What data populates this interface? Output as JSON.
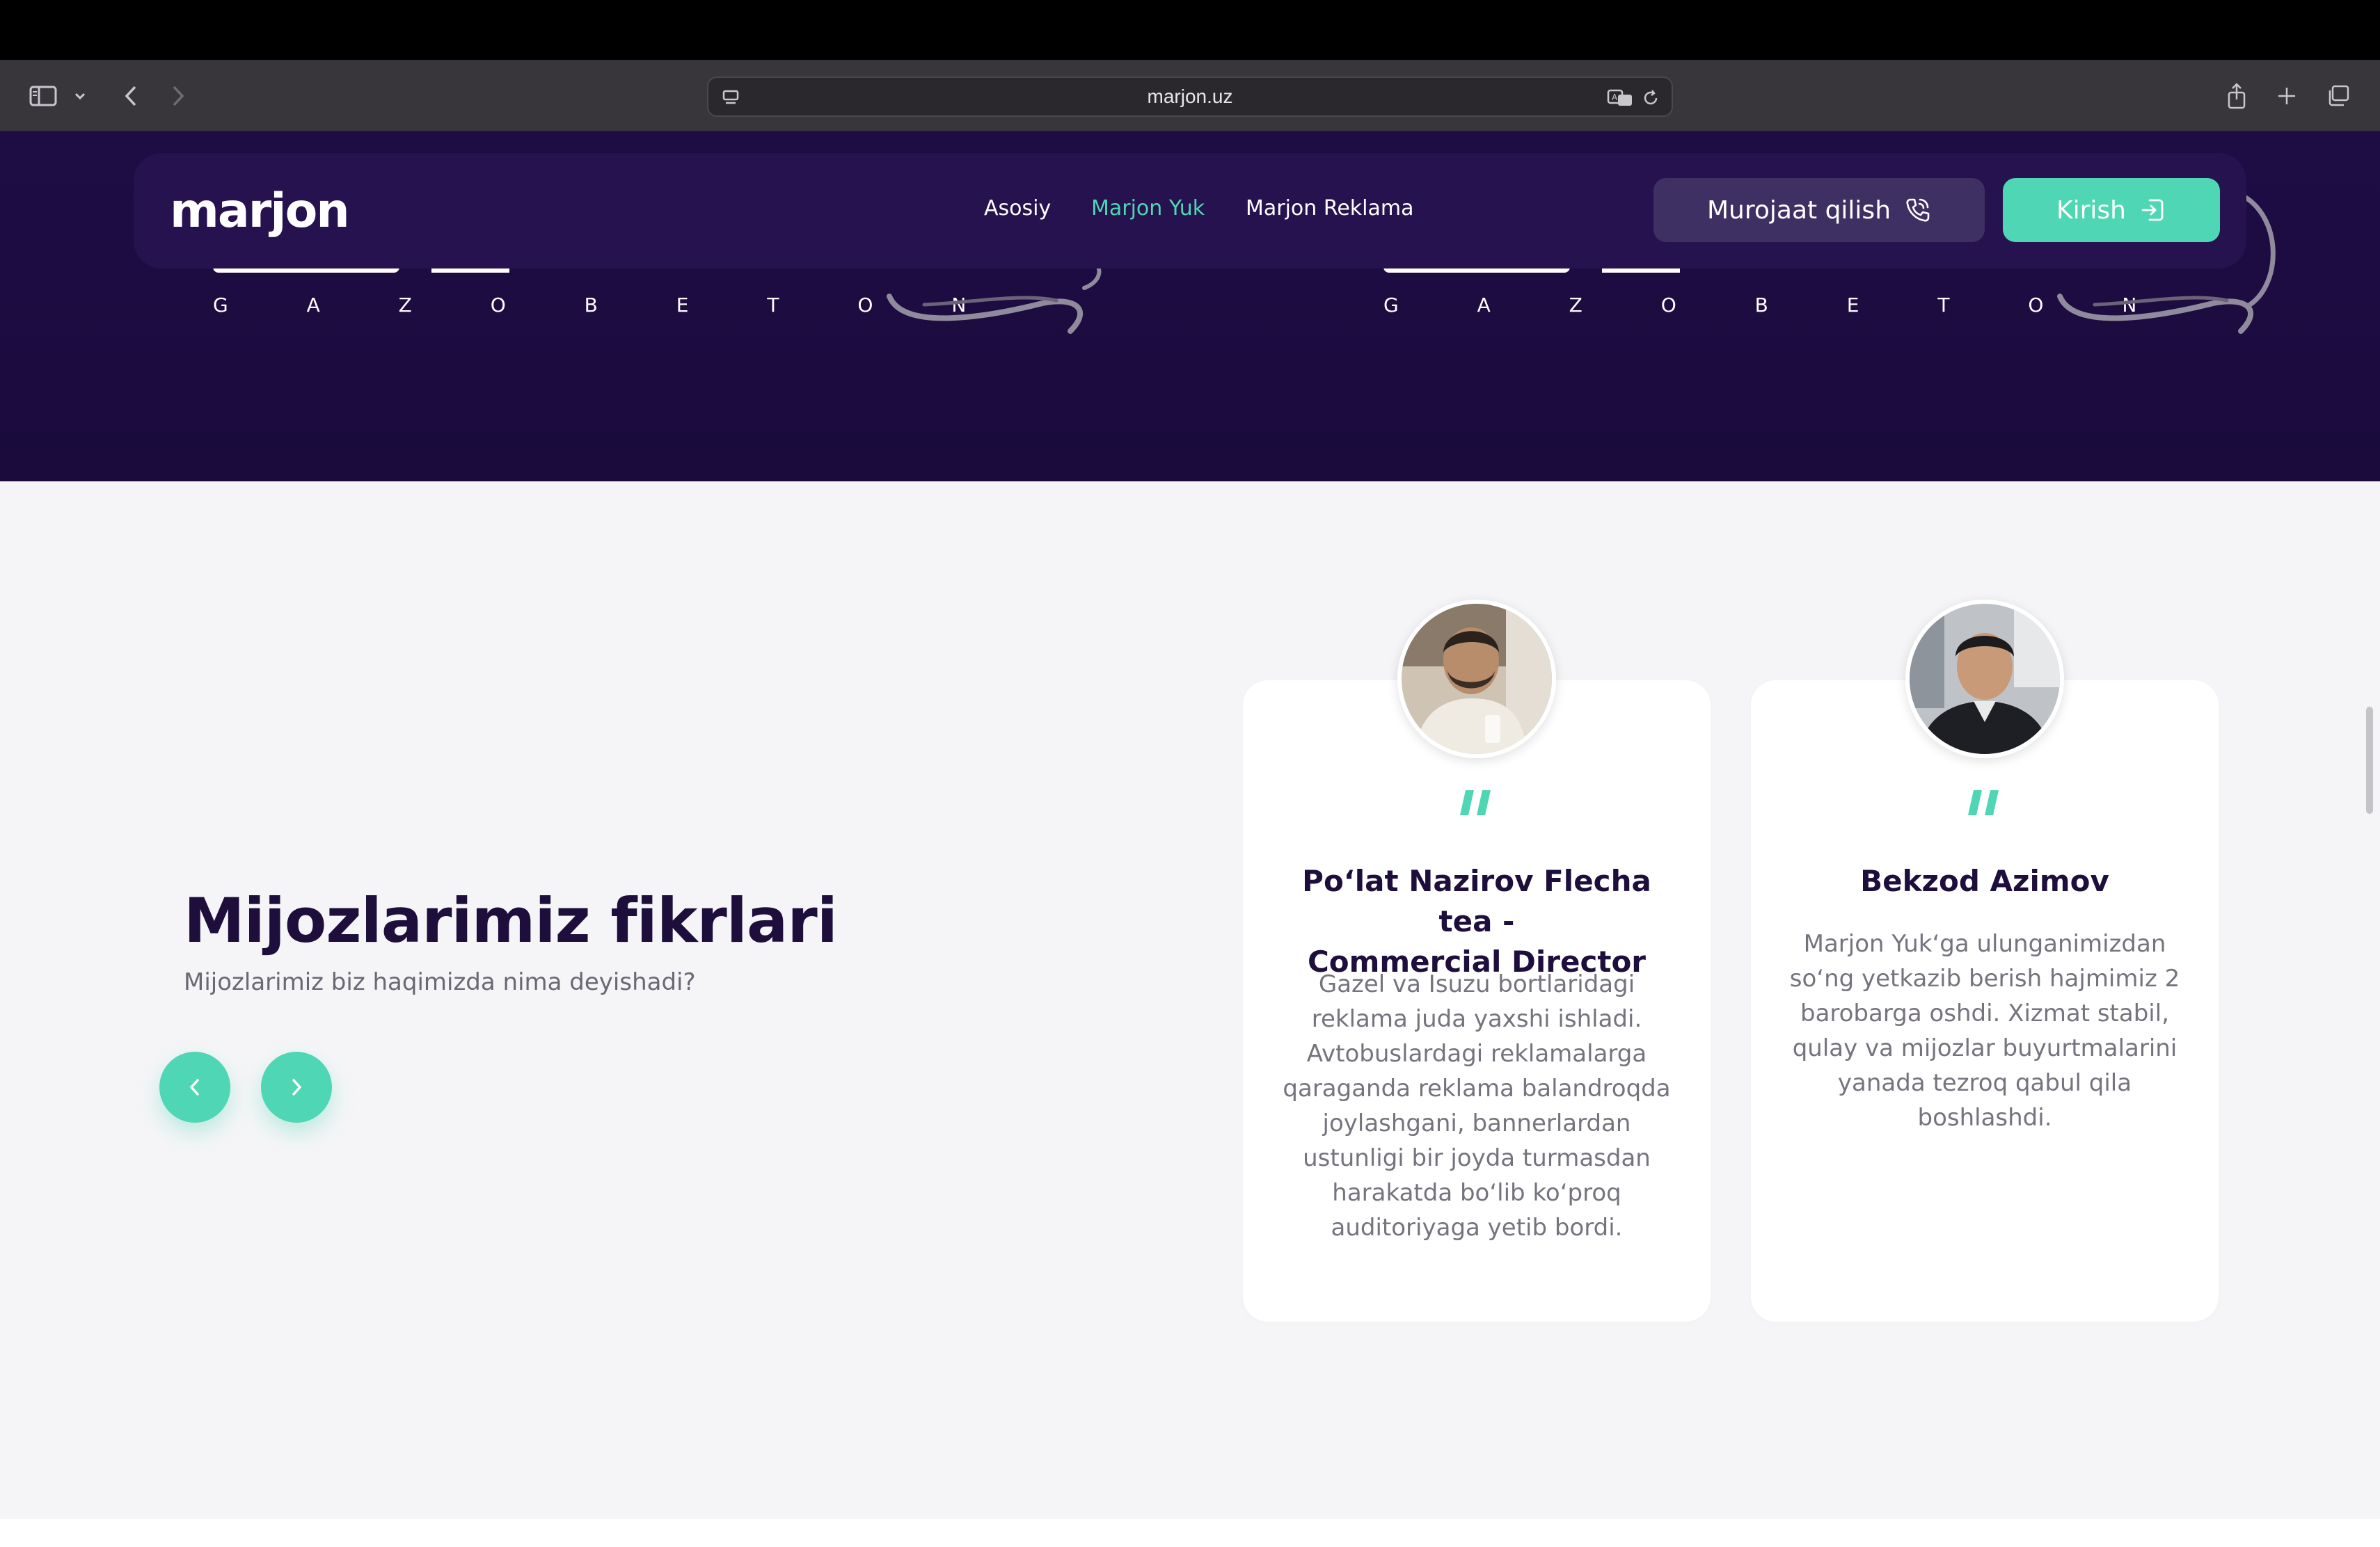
{
  "browser": {
    "url": "marjon.uz"
  },
  "hero": {
    "partner_logo_text": "G A Z O B E T O N"
  },
  "navbar": {
    "brand": "marjon",
    "links": [
      {
        "label": "Asosiy",
        "active": false
      },
      {
        "label": "Marjon Yuk",
        "active": true
      },
      {
        "label": "Marjon Reklama",
        "active": false
      }
    ],
    "contact_label": "Murojaat qilish",
    "login_label": "Kirish"
  },
  "reviews": {
    "title": "Mijozlarimiz fikrlari",
    "subtitle": "Mijozlarimiz biz haqimizda nima deyishadi?",
    "cards": [
      {
        "name_line1": "Po‘lat Nazirov Flecha tea -",
        "name_line2": "Commercial Director",
        "text_lines": [
          "Gazel va Isuzu bortlaridagi",
          "reklama juda yaxshi ishladi.",
          "Avtobuslardagi reklamalarga",
          "qaraganda reklama balandroqda",
          "joylashgani, bannerlardan",
          "ustunligi bir joyda turmasdan",
          "harakatda bo‘lib ko‘proq",
          "auditoriyaga yetib bordi."
        ]
      },
      {
        "name_line1": "Bekzod Azimov",
        "text_lines": [
          "Marjon Yuk‘ga ulunganimizdan",
          "so‘ng yetkazib berish hajmimiz 2",
          "barobarga oshdi. Xizmat stabil,",
          "qulay va mijozlar buyurtmalarini",
          "yanada tezroq qabul qila",
          "boshlashdi."
        ]
      }
    ]
  },
  "colors": {
    "accent": "#4fd6b4",
    "hero_bg": "#1e0c45",
    "navbar_bg": "#25124f",
    "heading": "#1d0e3c",
    "body_text": "#77737e"
  }
}
